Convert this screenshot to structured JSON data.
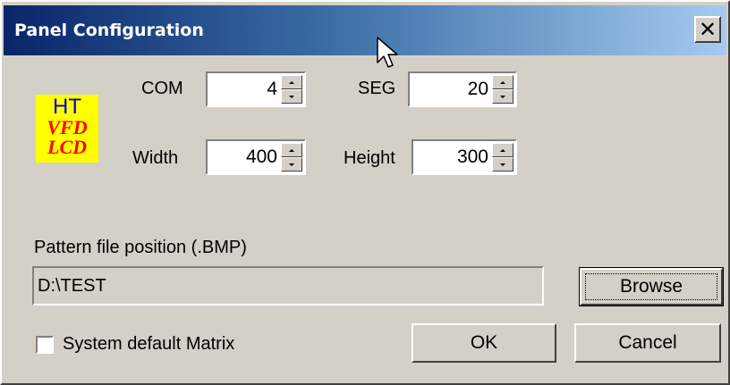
{
  "window": {
    "title": "Panel Configuration",
    "close_glyph": "✕"
  },
  "logo": {
    "line1": "HT",
    "line2": "VFD",
    "line3": "LCD"
  },
  "fields": {
    "com": {
      "label": "COM",
      "value": "4"
    },
    "seg": {
      "label": "SEG",
      "value": "20"
    },
    "width": {
      "label": "Width",
      "value": "400"
    },
    "height": {
      "label": "Height",
      "value": "300"
    }
  },
  "pattern": {
    "label": "Pattern file position (.BMP)",
    "path": "D:\\TEST",
    "browse_label": "Browse"
  },
  "options": {
    "system_default_matrix_label": "System default Matrix",
    "system_default_matrix_checked": false
  },
  "buttons": {
    "ok_label": "OK",
    "cancel_label": "Cancel"
  },
  "colors": {
    "dialog_bg": "#d4d0c8",
    "title_start": "#0a246a",
    "title_end": "#a6caf0",
    "logo_bg": "#ffff00"
  }
}
